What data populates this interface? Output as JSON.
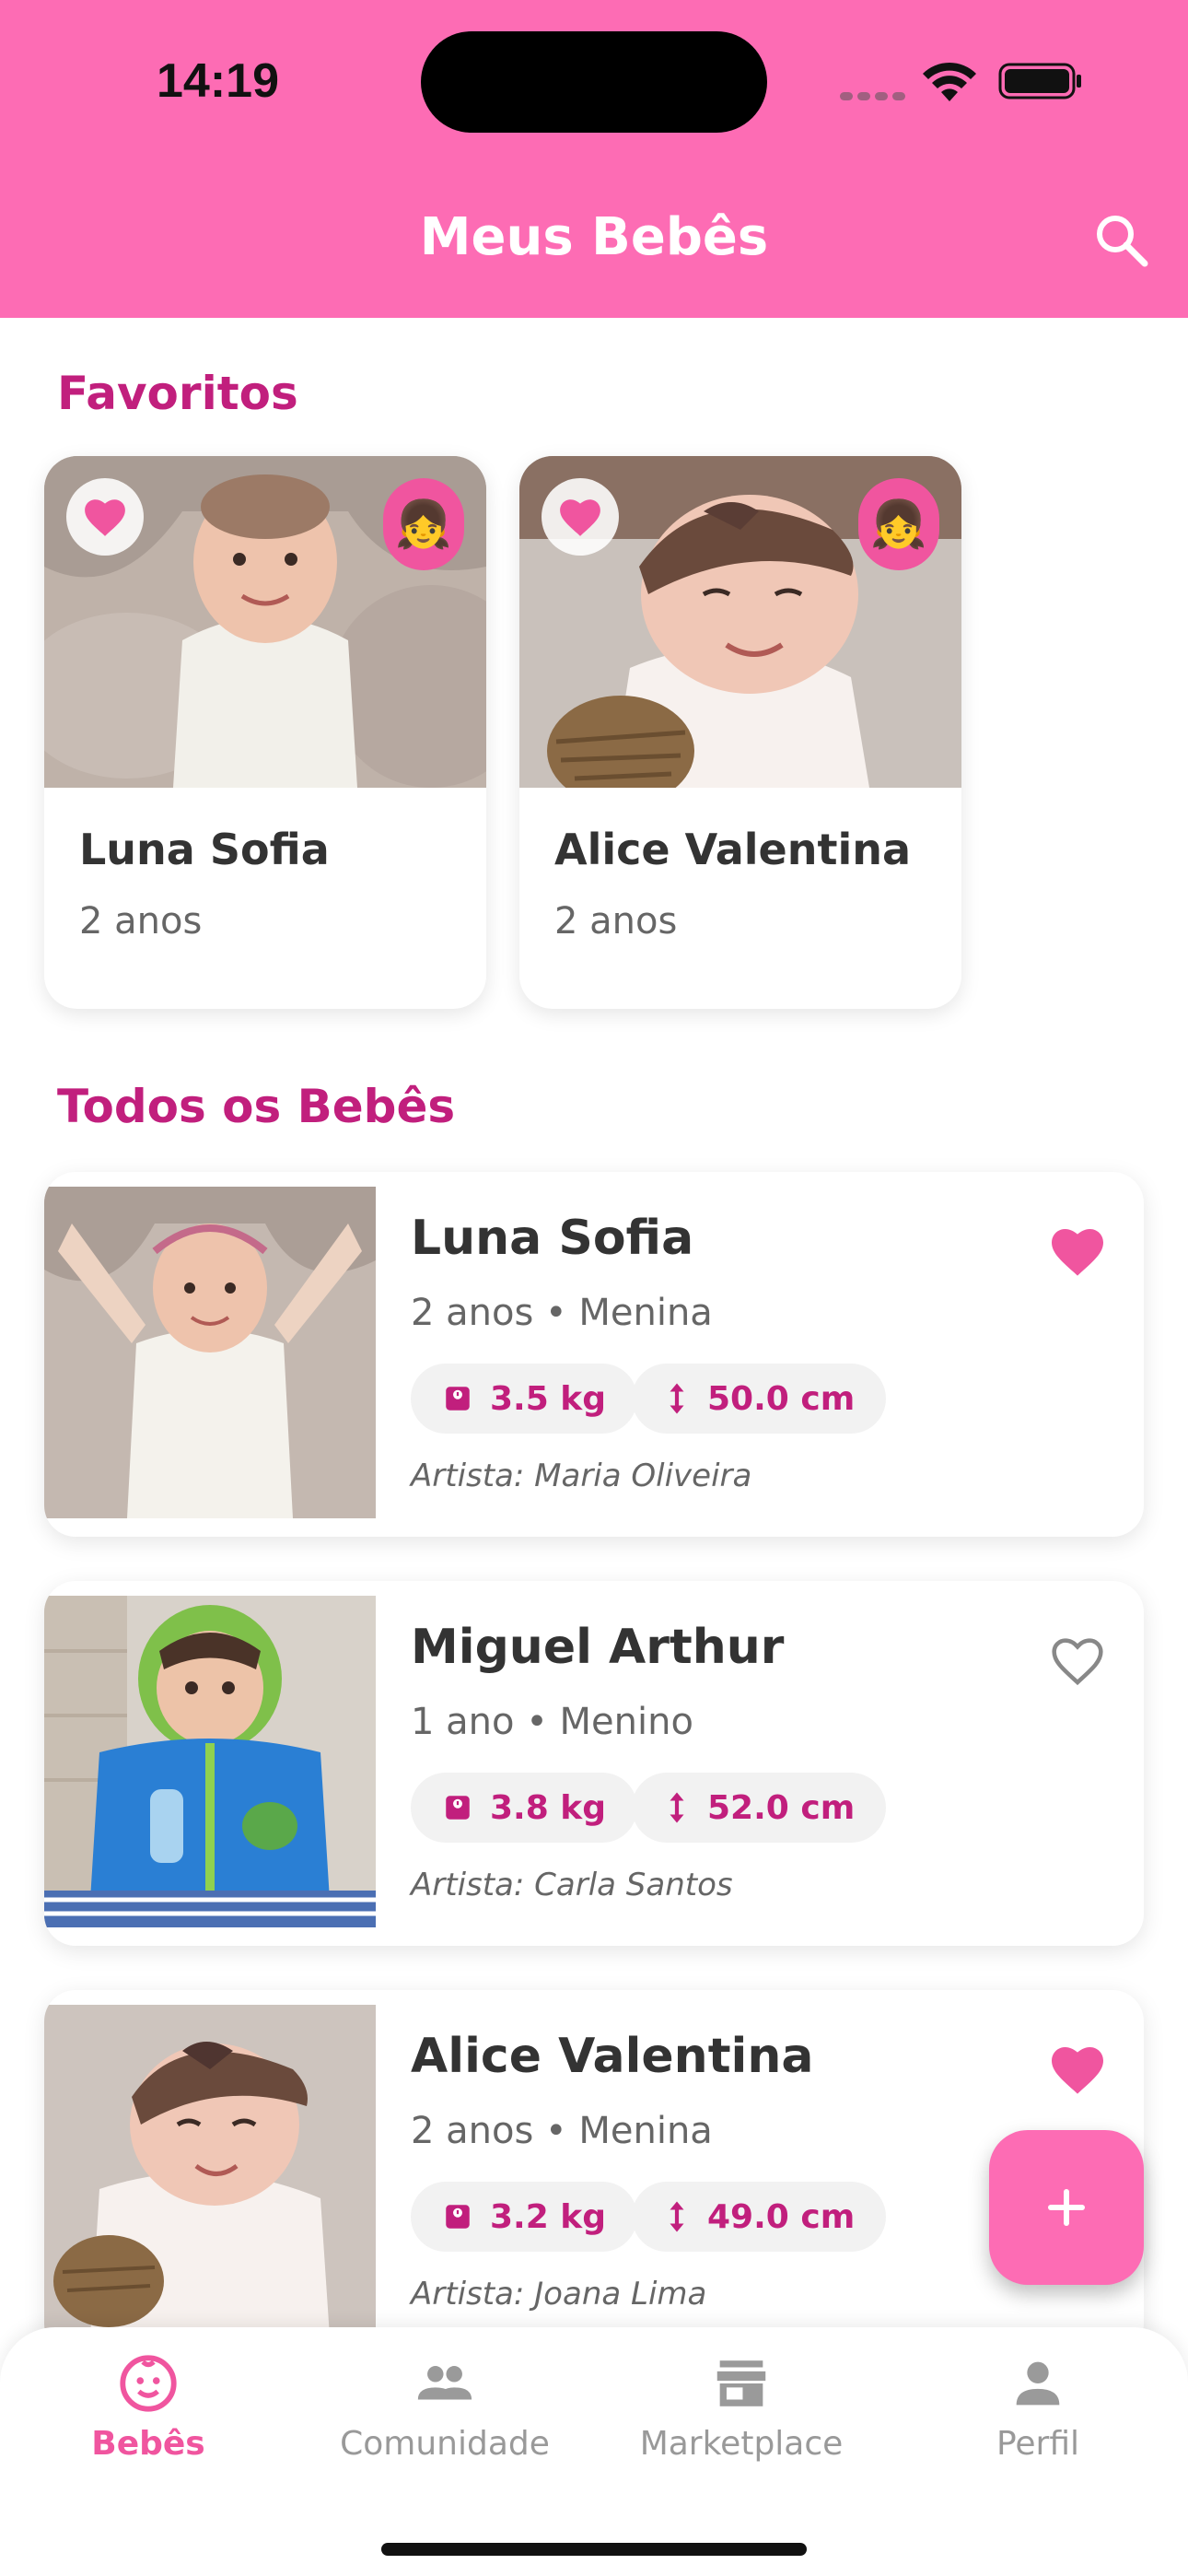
{
  "status_bar": {
    "time": "14:19"
  },
  "header": {
    "title": "Meus Bebês"
  },
  "favorites": {
    "title": "Favoritos",
    "items": [
      {
        "name": "Luna Sofia",
        "age": "2 anos",
        "favorite": true,
        "gender_emoji": "👧"
      },
      {
        "name": "Alice Valentina",
        "age": "2 anos",
        "favorite": true,
        "gender_emoji": "👧"
      }
    ]
  },
  "all_babies": {
    "title": "Todos os Bebês",
    "items": [
      {
        "name": "Luna Sofia",
        "meta": "2 anos • Menina",
        "weight": "3.5 kg",
        "height": "50.0 cm",
        "artist": "Artista: Maria Oliveira",
        "favorite": true
      },
      {
        "name": "Miguel Arthur",
        "meta": "1 ano • Menino",
        "weight": "3.8 kg",
        "height": "52.0 cm",
        "artist": "Artista: Carla Santos",
        "favorite": false
      },
      {
        "name": "Alice Valentina",
        "meta": "2 anos • Menina",
        "weight": "3.2 kg",
        "height": "49.0 cm",
        "artist": "Artista: Joana Lima",
        "favorite": true
      }
    ]
  },
  "bottom_nav": {
    "items": [
      {
        "label": "Bebês",
        "icon": "baby-face-icon",
        "active": true
      },
      {
        "label": "Comunidade",
        "icon": "people-icon",
        "active": false
      },
      {
        "label": "Marketplace",
        "icon": "store-icon",
        "active": false
      },
      {
        "label": "Perfil",
        "icon": "person-icon",
        "active": false
      }
    ]
  },
  "colors": {
    "brand_pink": "#fd6cb4",
    "accent_magenta": "#c11f7d",
    "heart_pink": "#f0559f"
  }
}
